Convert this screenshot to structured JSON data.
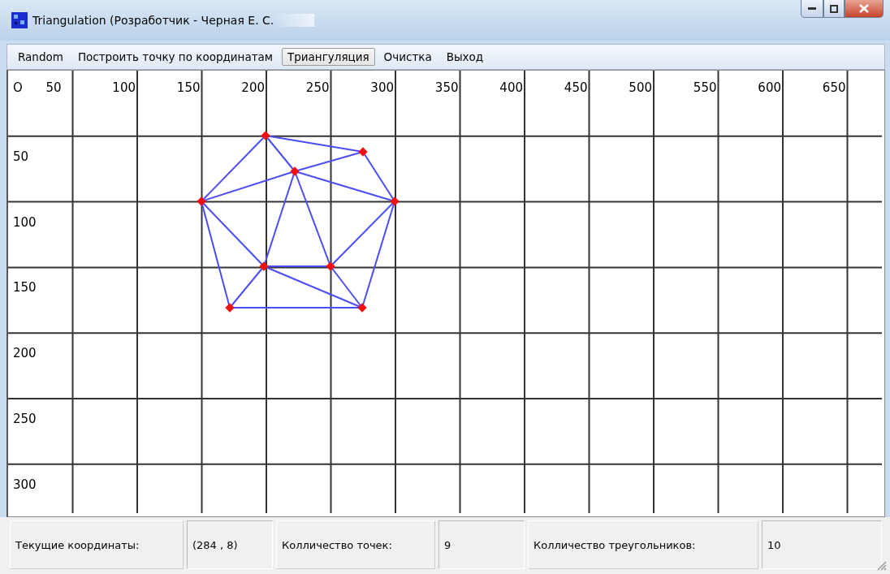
{
  "window": {
    "title": "Triangulation (Розработчик - Черная Е. С."
  },
  "menu": [
    {
      "label": "Random",
      "selected": false
    },
    {
      "label": "Построить точку по координатам",
      "selected": false
    },
    {
      "label": "Триангуляция",
      "selected": true
    },
    {
      "label": "Очистка",
      "selected": false
    },
    {
      "label": "Выход",
      "selected": false
    }
  ],
  "canvas": {
    "origin_label": "O",
    "x_labels": [
      "50",
      "100",
      "150",
      "200",
      "250",
      "300",
      "350",
      "400",
      "450",
      "500",
      "550",
      "600",
      "650"
    ],
    "y_labels": [
      "50",
      "100",
      "150",
      "200",
      "250",
      "300"
    ]
  },
  "status_bar": [
    {
      "label": "Текущие координаты:",
      "value": "(284 , 8)"
    },
    {
      "label": "Колличество точек:",
      "value": "9"
    },
    {
      "label": "Колличество треугольников:",
      "value": "10"
    }
  ]
}
